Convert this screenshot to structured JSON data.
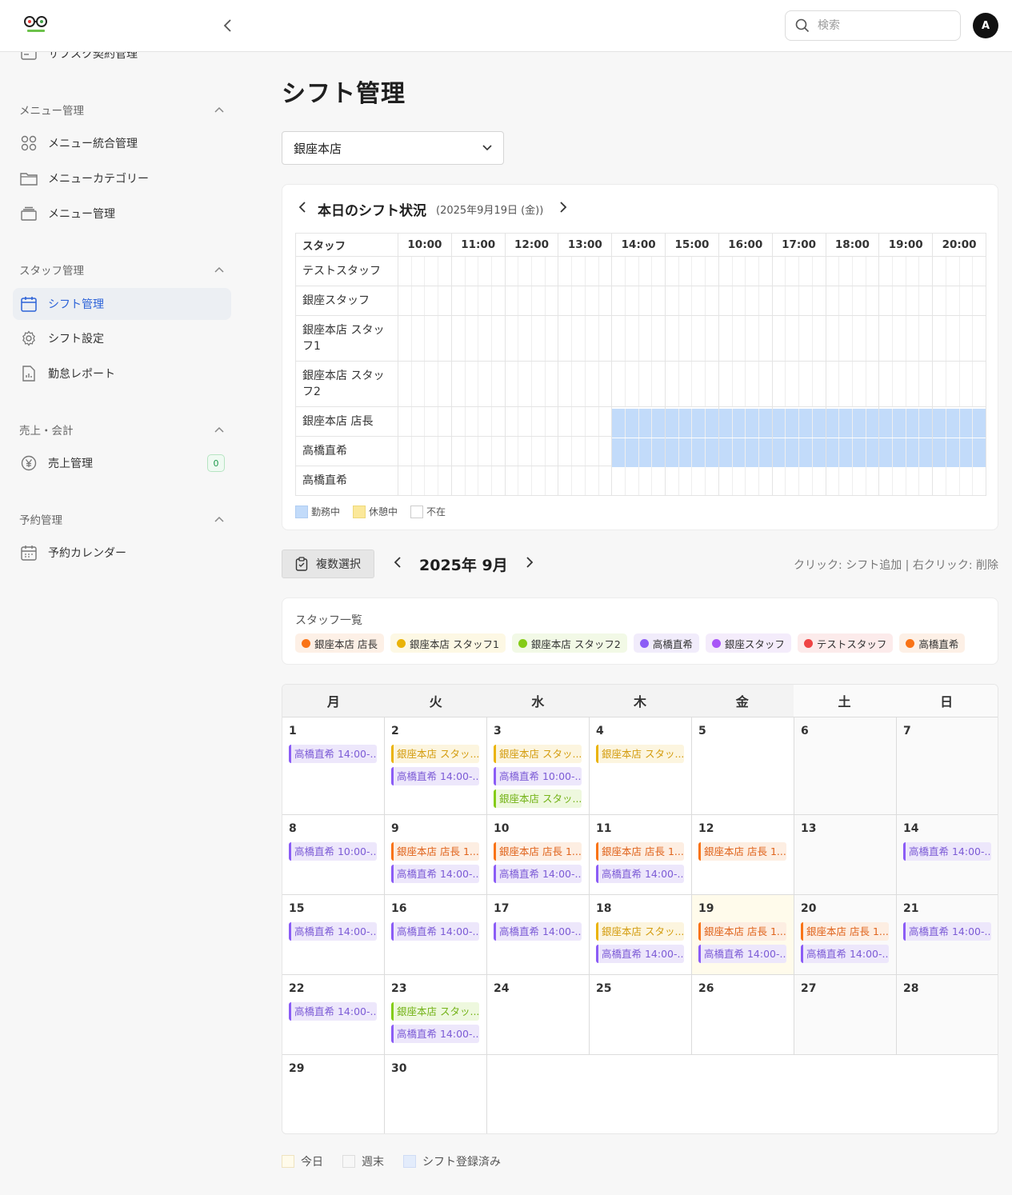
{
  "header": {
    "search_placeholder": "検索",
    "avatar_initial": "A"
  },
  "sidebar": {
    "partial_item": "サブスク契約管理",
    "sections": [
      {
        "title": "メニュー管理",
        "items": [
          "メニュー統合管理",
          "メニューカテゴリー",
          "メニュー管理"
        ]
      },
      {
        "title": "スタッフ管理",
        "items": [
          "シフト管理",
          "シフト設定",
          "勤怠レポート"
        ]
      },
      {
        "title": "売上・会計",
        "items": [
          "売上管理"
        ]
      },
      {
        "title": "予約管理",
        "items": [
          "予約カレンダー"
        ]
      }
    ],
    "active_item": "シフト管理",
    "sales_badge": "0"
  },
  "page": {
    "title": "シフト管理",
    "store": "銀座本店"
  },
  "today_shift": {
    "title": "本日のシフト状況",
    "date": "(2025年9月19日 (金))",
    "staff_col": "スタッフ",
    "hours": [
      "10:00",
      "11:00",
      "12:00",
      "13:00",
      "14:00",
      "15:00",
      "16:00",
      "17:00",
      "18:00",
      "19:00",
      "20:00"
    ],
    "rows": [
      {
        "name": "テストスタッフ",
        "working_from_hour": null
      },
      {
        "name": "銀座スタッフ",
        "working_from_hour": null
      },
      {
        "name": "銀座本店 スタッフ1",
        "working_from_hour": null
      },
      {
        "name": "銀座本店 スタッフ2",
        "working_from_hour": null
      },
      {
        "name": "銀座本店 店長",
        "working_from_hour": "14:00"
      },
      {
        "name": "高橋直希",
        "working_from_hour": "14:00"
      },
      {
        "name": "高橋直希",
        "working_from_hour": null
      }
    ],
    "legend": {
      "working": "勤務中",
      "break": "休憩中",
      "absent": "不在"
    },
    "colors": {
      "working": "#c2dbfa",
      "break": "#fbe89a",
      "absent": "#ffffff"
    }
  },
  "toolbar": {
    "multi_select": "複数選択",
    "month": "2025年 9月",
    "hint": "クリック: シフト追加 | 右クリック: 削除"
  },
  "staff_list": {
    "title": "スタッフ一覧",
    "staff": [
      {
        "name": "銀座本店 店長",
        "color": "#f97316",
        "bg": "#fdf0e6"
      },
      {
        "name": "銀座本店 スタッフ1",
        "color": "#eab308",
        "bg": "#fdf8e4"
      },
      {
        "name": "銀座本店 スタッフ2",
        "color": "#84cc16",
        "bg": "#f2f9e6"
      },
      {
        "name": "高橋直希",
        "color": "#8b5cf6",
        "bg": "#f1ecfb"
      },
      {
        "name": "銀座スタッフ",
        "color": "#a855f7",
        "bg": "#f4ecfb"
      },
      {
        "name": "テストスタッフ",
        "color": "#ef4444",
        "bg": "#fcebeb"
      },
      {
        "name": "高橋直希",
        "color": "#f97316",
        "bg": "#fdf0e6"
      }
    ]
  },
  "calendar": {
    "weekdays": [
      "月",
      "火",
      "水",
      "木",
      "金",
      "土",
      "日"
    ],
    "today": 19,
    "days": [
      {
        "d": 1,
        "events": [
          {
            "t": "高橋直希 14:00-...",
            "k": "purple"
          }
        ]
      },
      {
        "d": 2,
        "events": [
          {
            "t": "銀座本店 スタッ...",
            "k": "yellow"
          },
          {
            "t": "高橋直希 14:00-...",
            "k": "purple"
          }
        ]
      },
      {
        "d": 3,
        "events": [
          {
            "t": "銀座本店 スタッ...",
            "k": "yellow"
          },
          {
            "t": "高橋直希 10:00-...",
            "k": "purple"
          },
          {
            "t": "銀座本店 スタッ...",
            "k": "green"
          }
        ]
      },
      {
        "d": 4,
        "events": [
          {
            "t": "銀座本店 スタッ...",
            "k": "yellow"
          }
        ]
      },
      {
        "d": 5,
        "events": []
      },
      {
        "d": 6,
        "events": []
      },
      {
        "d": 7,
        "events": []
      },
      {
        "d": 8,
        "events": [
          {
            "t": "高橋直希 10:00-...",
            "k": "purple"
          }
        ]
      },
      {
        "d": 9,
        "events": [
          {
            "t": "銀座本店 店長 1...",
            "k": "orange"
          },
          {
            "t": "高橋直希 14:00-...",
            "k": "purple"
          }
        ]
      },
      {
        "d": 10,
        "events": [
          {
            "t": "銀座本店 店長 1...",
            "k": "orange"
          },
          {
            "t": "高橋直希 14:00-...",
            "k": "purple"
          }
        ]
      },
      {
        "d": 11,
        "events": [
          {
            "t": "銀座本店 店長 1...",
            "k": "orange"
          },
          {
            "t": "高橋直希 14:00-...",
            "k": "purple"
          }
        ]
      },
      {
        "d": 12,
        "events": [
          {
            "t": "銀座本店 店長 1...",
            "k": "orange"
          }
        ]
      },
      {
        "d": 13,
        "events": []
      },
      {
        "d": 14,
        "events": [
          {
            "t": "高橋直希 14:00-...",
            "k": "purple"
          }
        ]
      },
      {
        "d": 15,
        "events": [
          {
            "t": "高橋直希 14:00-...",
            "k": "purple"
          }
        ]
      },
      {
        "d": 16,
        "events": [
          {
            "t": "高橋直希 14:00-...",
            "k": "purple"
          }
        ]
      },
      {
        "d": 17,
        "events": [
          {
            "t": "高橋直希 14:00-...",
            "k": "purple"
          }
        ]
      },
      {
        "d": 18,
        "events": [
          {
            "t": "銀座本店 スタッ...",
            "k": "yellow"
          },
          {
            "t": "高橋直希 14:00-...",
            "k": "purple"
          }
        ]
      },
      {
        "d": 19,
        "events": [
          {
            "t": "銀座本店 店長 1...",
            "k": "orange"
          },
          {
            "t": "高橋直希 14:00-...",
            "k": "purple"
          }
        ]
      },
      {
        "d": 20,
        "events": [
          {
            "t": "銀座本店 店長 1...",
            "k": "orange"
          },
          {
            "t": "高橋直希 14:00-...",
            "k": "purple"
          }
        ]
      },
      {
        "d": 21,
        "events": [
          {
            "t": "高橋直希 14:00-...",
            "k": "purple"
          }
        ]
      },
      {
        "d": 22,
        "events": [
          {
            "t": "高橋直希 14:00-...",
            "k": "purple"
          }
        ]
      },
      {
        "d": 23,
        "events": [
          {
            "t": "銀座本店 スタッ...",
            "k": "green"
          },
          {
            "t": "高橋直希 14:00-...",
            "k": "purple"
          }
        ]
      },
      {
        "d": 24,
        "events": []
      },
      {
        "d": 25,
        "events": []
      },
      {
        "d": 26,
        "events": []
      },
      {
        "d": 27,
        "events": []
      },
      {
        "d": 28,
        "events": []
      },
      {
        "d": 29,
        "events": []
      },
      {
        "d": 30,
        "events": []
      }
    ],
    "event_colors": {
      "purple": {
        "border": "#8b5cf6",
        "bg": "#ede7fb",
        "text": "#7c5bd6"
      },
      "yellow": {
        "border": "#eab308",
        "bg": "#fcf5df",
        "text": "#d49d10"
      },
      "orange": {
        "border": "#f97316",
        "bg": "#fdeee2",
        "text": "#e0641c"
      },
      "green": {
        "border": "#84cc16",
        "bg": "#eef8de",
        "text": "#74b318"
      }
    }
  },
  "legend": {
    "today": "今日",
    "weekend": "週末",
    "registered": "シフト登録済み",
    "colors": {
      "today": "#fffbeb",
      "weekend": "#f7f7f7",
      "registered": "#e3ecfb"
    }
  }
}
